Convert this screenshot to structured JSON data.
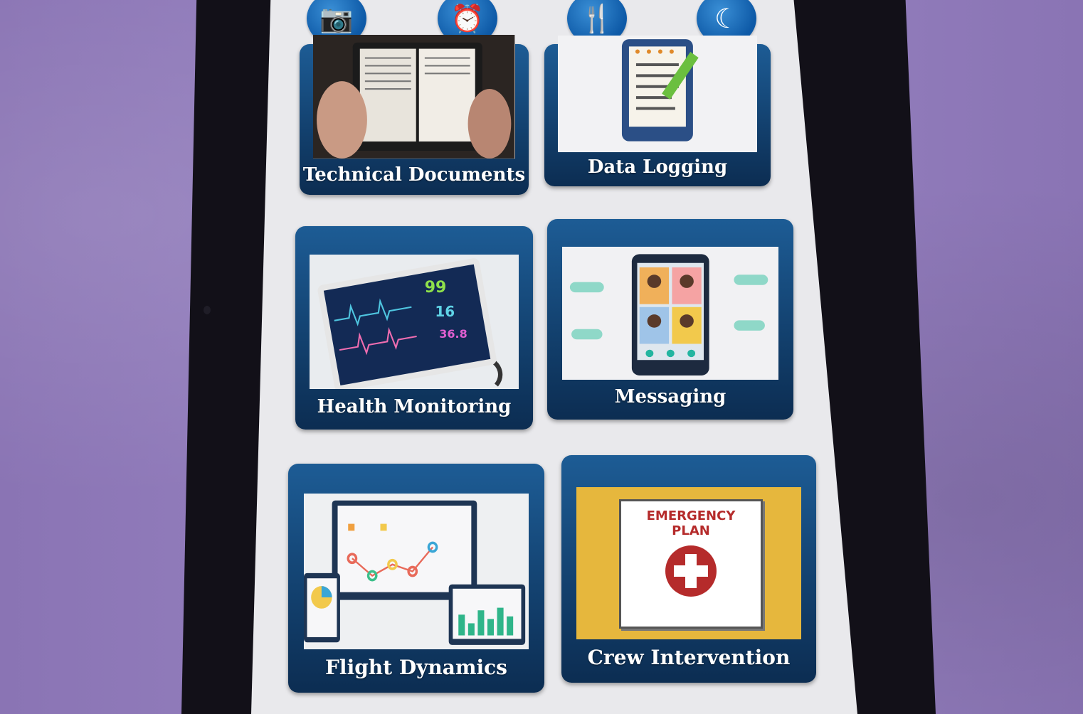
{
  "top_icons": [
    {
      "name": "camera-icon",
      "glyph": "📷"
    },
    {
      "name": "alarm-clock-icon",
      "glyph": "⏰"
    },
    {
      "name": "fork-knife-icon",
      "glyph": "🍴"
    },
    {
      "name": "moon-sleep-icon",
      "glyph": "☾"
    }
  ],
  "tiles": [
    {
      "label": "Technical Documents"
    },
    {
      "label": "Data Logging"
    },
    {
      "label": "Health Monitoring"
    },
    {
      "label": "Messaging"
    },
    {
      "label": "Flight Dynamics"
    },
    {
      "label": "Crew Intervention"
    }
  ],
  "health_readouts": [
    "99",
    "16",
    "36.8"
  ],
  "emergency_plan": {
    "line1": "EMERGENCY",
    "line2": "PLAN"
  },
  "colors": {
    "tile_blue": "#123f6c",
    "icon_blue": "#0e5aa7",
    "cloth_purple": "#8e79b7",
    "plan_gold": "#e6b73d",
    "plan_red": "#b52b2b"
  }
}
